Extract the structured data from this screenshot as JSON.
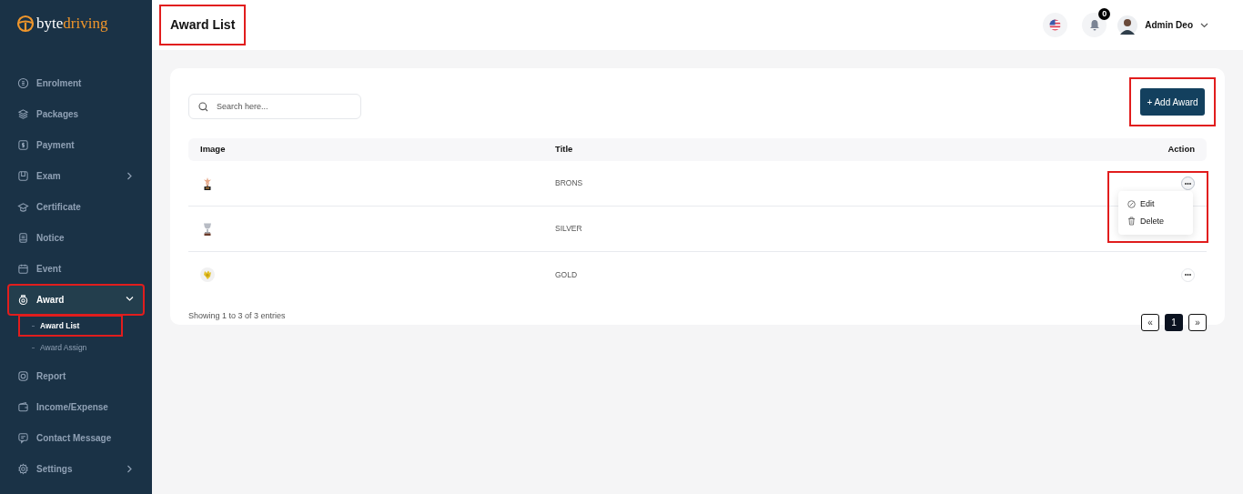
{
  "brand": {
    "part_1": "byte",
    "part_2": "driving"
  },
  "sidebar": {
    "items": [
      {
        "label": "Enrolment",
        "has_children": false,
        "selected": false,
        "highlighted": false
      },
      {
        "label": "Packages",
        "has_children": false,
        "selected": false,
        "highlighted": false
      },
      {
        "label": "Payment",
        "has_children": false,
        "selected": false,
        "highlighted": false
      },
      {
        "label": "Exam",
        "expanded": false,
        "has_children": true,
        "selected": false,
        "highlighted": false
      },
      {
        "label": "Certificate",
        "has_children": false,
        "selected": false,
        "highlighted": false
      },
      {
        "label": "Notice",
        "has_children": false,
        "selected": false,
        "highlighted": false
      },
      {
        "label": "Event",
        "has_children": false,
        "selected": false,
        "highlighted": false
      },
      {
        "label": "Award",
        "expanded": true,
        "has_children": true,
        "selected": true,
        "highlighted": true,
        "children": [
          {
            "label": "Award List",
            "selected": true,
            "highlighted": true
          },
          {
            "label": "Award Assign",
            "selected": false,
            "highlighted": false
          }
        ]
      },
      {
        "label": "Report",
        "has_children": false,
        "selected": false,
        "highlighted": false
      },
      {
        "label": "Income/Expense",
        "has_children": false,
        "selected": false,
        "highlighted": false
      },
      {
        "label": "Contact Message",
        "has_children": false,
        "selected": false,
        "highlighted": false
      },
      {
        "label": "Settings",
        "expanded": false,
        "has_children": true,
        "selected": false,
        "highlighted": false
      }
    ]
  },
  "header": {
    "title": "Award List",
    "title_highlighted": true,
    "notification_count": "0",
    "user_name": "Admin Deo"
  },
  "search": {
    "placeholder": "Search here..."
  },
  "add_button": {
    "label": "+ Add Award",
    "highlighted": true
  },
  "table": {
    "columns": [
      "Image",
      "Title",
      "Action"
    ],
    "rows": [
      {
        "image": {
          "kind": "picture"
        },
        "title": "BRONS",
        "menu_open": true,
        "menu_items": [
          "Edit",
          "Delete"
        ]
      },
      {
        "image": {
          "kind": "picture"
        },
        "title": "SILVER",
        "menu_open": false
      },
      {
        "image": {
          "kind": "picture"
        },
        "title": "GOLD",
        "menu_open": false
      }
    ]
  },
  "footer": {
    "summary": "Showing 1 to 3 of 3 entries",
    "pages": [
      {
        "label": "«",
        "selected": false
      },
      {
        "label": "1",
        "selected": true
      },
      {
        "label": "»",
        "selected": false
      }
    ]
  }
}
